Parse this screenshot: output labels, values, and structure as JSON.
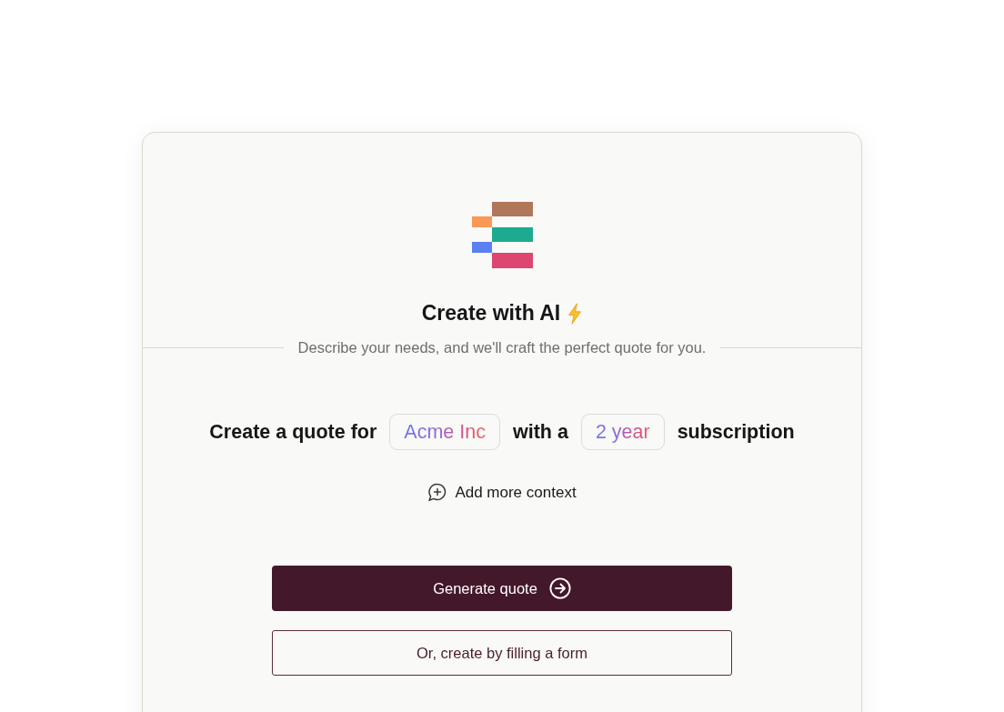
{
  "header": {
    "title": "Create with AI",
    "subtitle": "Describe your needs, and we'll craft the perfect quote for you."
  },
  "prompt": {
    "segments": [
      {
        "kind": "text",
        "text": "Create a quote for"
      },
      {
        "kind": "field",
        "value": "Acme Inc"
      },
      {
        "kind": "text",
        "text": "with a"
      },
      {
        "kind": "field",
        "value": "2 year"
      },
      {
        "kind": "text",
        "text": "subscription"
      }
    ]
  },
  "add_context": {
    "label": "Add more context"
  },
  "buttons": [
    {
      "kind": "primary",
      "label": "Generate quote"
    },
    {
      "kind": "secondary",
      "label": "Or, create by filling a form"
    }
  ]
}
